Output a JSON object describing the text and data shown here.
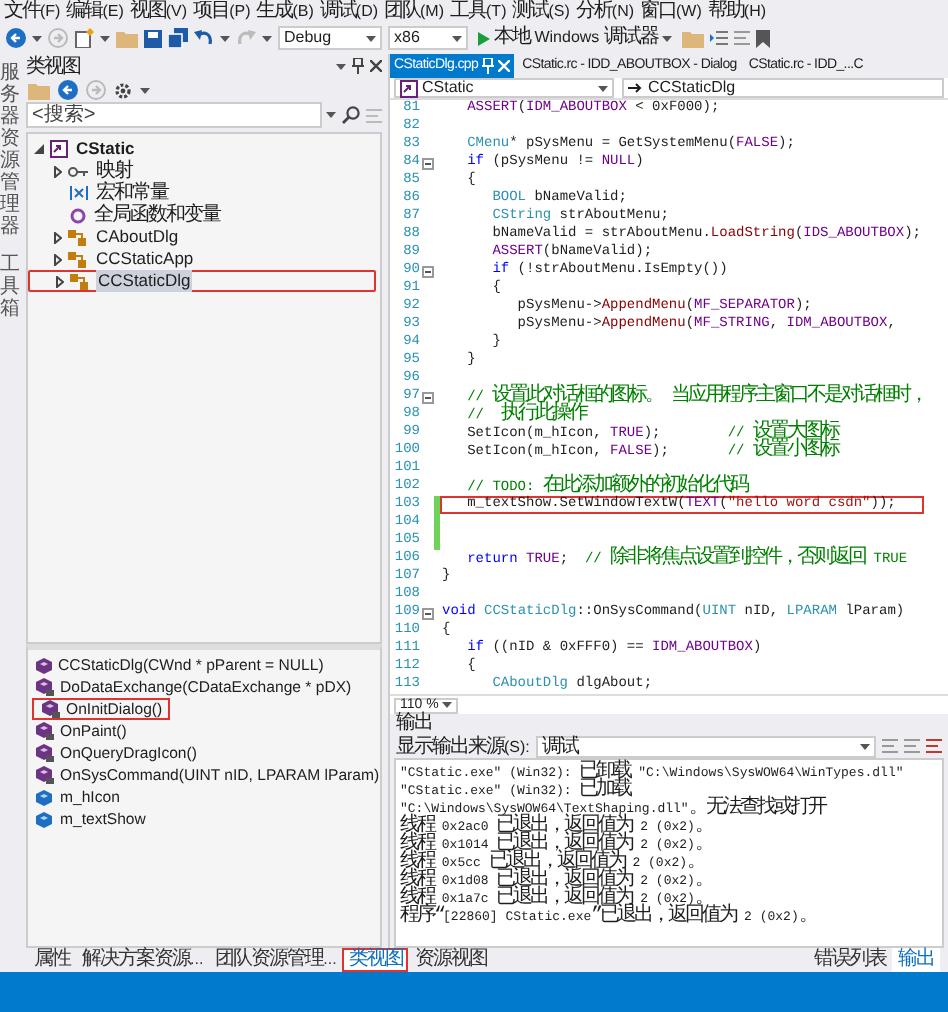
{
  "menu": [
    "文件(F)",
    "编辑(E)",
    "视图(V)",
    "项目(P)",
    "生成(B)",
    "调试(D)",
    "团队(M)",
    "工具(T)",
    "测试(S)",
    "分析(N)",
    "窗口(W)",
    "帮助(H)"
  ],
  "toolbar": {
    "configuration": "Debug",
    "platform": "x86",
    "debugger": "本地 Windows 调试器"
  },
  "side_tabs": [
    "服务器资源管理器",
    "工具箱"
  ],
  "class_view": {
    "title": "类视图",
    "search": {
      "placeholder": "<搜索>"
    },
    "tree": [
      {
        "label": "CStatic",
        "kind": "project",
        "expanded": true,
        "selected": false,
        "annotated": false,
        "children": [
          {
            "label": "映射",
            "kind": "map",
            "expanded": false,
            "selected": false,
            "annotated": false
          },
          {
            "label": "宏和常量",
            "kind": "macro",
            "selected": false,
            "annotated": false
          },
          {
            "label": "全局函数和变量",
            "kind": "global",
            "selected": false,
            "annotated": false
          },
          {
            "label": "CAboutDlg",
            "kind": "class",
            "expanded": false,
            "selected": false,
            "annotated": false
          },
          {
            "label": "CCStaticApp",
            "kind": "class",
            "expanded": false,
            "selected": false,
            "annotated": false
          },
          {
            "label": "CCStaticDlg",
            "kind": "class",
            "expanded": false,
            "selected": true,
            "annotated": true
          }
        ]
      }
    ],
    "members": [
      {
        "label": "CCStaticDlg(CWnd * pParent = NULL)",
        "kind": "method",
        "annotated": false
      },
      {
        "label": "DoDataExchange(CDataExchange * pDX)",
        "kind": "protected-method",
        "annotated": false
      },
      {
        "label": "OnInitDialog()",
        "kind": "protected-method",
        "annotated": true
      },
      {
        "label": "OnPaint()",
        "kind": "protected-method",
        "annotated": false
      },
      {
        "label": "OnQueryDragIcon()",
        "kind": "protected-method",
        "annotated": false
      },
      {
        "label": "OnSysCommand(UINT nID, LPARAM lParam)",
        "kind": "protected-method",
        "annotated": false
      },
      {
        "label": "m_hIcon",
        "kind": "field",
        "annotated": false
      },
      {
        "label": "m_textShow",
        "kind": "field",
        "annotated": false
      }
    ]
  },
  "editor": {
    "tabs": [
      {
        "label": "CStaticDlg.cpp",
        "selected": true
      },
      {
        "label": "CStatic.rc - IDD_ABOUTBOX - Dialog",
        "selected": false
      },
      {
        "label": "CStatic.rc - IDD_...C",
        "selected": false
      }
    ],
    "scope": "CStatic",
    "member": "CCStaticDlg",
    "zoom": "110 %",
    "lines": [
      {
        "number": "81",
        "tokens": [
          {
            "text": "   ASSERT",
            "kind": "macro"
          },
          {
            "text": "(",
            "kind": "plain"
          },
          {
            "text": "IDM_ABOUTBOX",
            "kind": "macro"
          },
          {
            "text": " < 0xF000);",
            "kind": "plain"
          }
        ]
      },
      {
        "number": "82"
      },
      {
        "number": "83",
        "tokens": [
          {
            "text": "   CMenu",
            "kind": "type"
          },
          {
            "text": "* pSysMenu = GetSystemMenu(",
            "kind": "plain"
          },
          {
            "text": "FALSE",
            "kind": "macro"
          },
          {
            "text": ");",
            "kind": "plain"
          }
        ]
      },
      {
        "number": "84",
        "fold": true,
        "tokens": [
          {
            "text": "   if",
            "kind": "keyword"
          },
          {
            "text": " (pSysMenu != ",
            "kind": "plain"
          },
          {
            "text": "NULL",
            "kind": "macro"
          },
          {
            "text": ")",
            "kind": "plain"
          }
        ]
      },
      {
        "number": "85",
        "tokens": [
          {
            "text": "   {",
            "kind": "plain"
          }
        ]
      },
      {
        "number": "86",
        "tokens": [
          {
            "text": "      BOOL",
            "kind": "type"
          },
          {
            "text": " bNameValid;",
            "kind": "plain"
          }
        ]
      },
      {
        "number": "87",
        "tokens": [
          {
            "text": "      CString",
            "kind": "type"
          },
          {
            "text": " strAboutMenu;",
            "kind": "plain"
          }
        ]
      },
      {
        "number": "88",
        "tokens": [
          {
            "text": "      bNameValid = strAboutMenu.",
            "kind": "plain"
          },
          {
            "text": "LoadString",
            "kind": "function"
          },
          {
            "text": "(",
            "kind": "plain"
          },
          {
            "text": "IDS_ABOUTBOX",
            "kind": "macro"
          },
          {
            "text": ");",
            "kind": "plain"
          }
        ]
      },
      {
        "number": "89",
        "tokens": [
          {
            "text": "      ASSERT",
            "kind": "macro"
          },
          {
            "text": "(bNameValid);",
            "kind": "plain"
          }
        ]
      },
      {
        "number": "90",
        "fold": true,
        "tokens": [
          {
            "text": "      if",
            "kind": "keyword"
          },
          {
            "text": " (!strAboutMenu.IsEmpty())",
            "kind": "plain"
          }
        ]
      },
      {
        "number": "91",
        "tokens": [
          {
            "text": "      {",
            "kind": "plain"
          }
        ]
      },
      {
        "number": "92",
        "tokens": [
          {
            "text": "         pSysMenu->",
            "kind": "plain"
          },
          {
            "text": "AppendMenu",
            "kind": "function"
          },
          {
            "text": "(",
            "kind": "plain"
          },
          {
            "text": "MF_SEPARATOR",
            "kind": "macro"
          },
          {
            "text": ");",
            "kind": "plain"
          }
        ]
      },
      {
        "number": "93",
        "tokens": [
          {
            "text": "         pSysMenu->",
            "kind": "plain"
          },
          {
            "text": "AppendMenu",
            "kind": "function"
          },
          {
            "text": "(",
            "kind": "plain"
          },
          {
            "text": "MF_STRING",
            "kind": "macro"
          },
          {
            "text": ", ",
            "kind": "plain"
          },
          {
            "text": "IDM_ABOUTBOX",
            "kind": "macro"
          },
          {
            "text": ",",
            "kind": "plain"
          }
        ]
      },
      {
        "number": "94",
        "tokens": [
          {
            "text": "      }",
            "kind": "plain"
          }
        ]
      },
      {
        "number": "95",
        "tokens": [
          {
            "text": "   }",
            "kind": "plain"
          }
        ]
      },
      {
        "number": "96"
      },
      {
        "number": "97",
        "fold": true,
        "tokens": [
          {
            "text": "   // 设置此对话框的图标。 当应用程序主窗口不是对话框时，",
            "kind": "comment"
          }
        ]
      },
      {
        "number": "98",
        "tokens": [
          {
            "text": "   //  执行此操作",
            "kind": "comment"
          }
        ]
      },
      {
        "number": "99",
        "tokens": [
          {
            "text": "   SetIcon(m_hIcon, ",
            "kind": "plain"
          },
          {
            "text": "TRUE",
            "kind": "macro"
          },
          {
            "text": ");        ",
            "kind": "plain"
          },
          {
            "text": "// 设置大图标",
            "kind": "comment"
          }
        ]
      },
      {
        "number": "100",
        "tokens": [
          {
            "text": "   SetIcon(m_hIcon, ",
            "kind": "plain"
          },
          {
            "text": "FALSE",
            "kind": "macro"
          },
          {
            "text": ");       ",
            "kind": "plain"
          },
          {
            "text": "// 设置小图标",
            "kind": "comment"
          }
        ]
      },
      {
        "number": "101"
      },
      {
        "number": "102",
        "tokens": [
          {
            "text": "   // TODO: 在此添加额外的初始化代码",
            "kind": "comment"
          }
        ]
      },
      {
        "number": "103",
        "changed": true,
        "annotated": true,
        "tokens": [
          {
            "text": "   m_textShow.SetWindowTextW(",
            "kind": "plain"
          },
          {
            "text": "TEXT",
            "kind": "macro"
          },
          {
            "text": "(",
            "kind": "plain"
          },
          {
            "text": "\"hello word csdn\"",
            "kind": "string"
          },
          {
            "text": "));",
            "kind": "plain"
          }
        ]
      },
      {
        "number": "104",
        "changed": true
      },
      {
        "number": "105",
        "changed": true
      },
      {
        "number": "106",
        "tokens": [
          {
            "text": "   return",
            "kind": "keyword"
          },
          {
            "text": " TRUE",
            "kind": "macro"
          },
          {
            "text": ";  ",
            "kind": "plain"
          },
          {
            "text": "// 除非将焦点设置到控件，否则返回 TRUE",
            "kind": "comment"
          }
        ]
      },
      {
        "number": "107",
        "tokens": [
          {
            "text": "}",
            "kind": "plain"
          }
        ]
      },
      {
        "number": "108"
      },
      {
        "number": "109",
        "fold": true,
        "tokens": [
          {
            "text": "void",
            "kind": "keyword"
          },
          {
            "text": " CCStaticDlg",
            "kind": "type"
          },
          {
            "text": "::OnSysCommand(",
            "kind": "plain"
          },
          {
            "text": "UINT",
            "kind": "type"
          },
          {
            "text": " nID, ",
            "kind": "plain"
          },
          {
            "text": "LPARAM",
            "kind": "type"
          },
          {
            "text": " lParam)",
            "kind": "plain"
          }
        ]
      },
      {
        "number": "110",
        "tokens": [
          {
            "text": "{",
            "kind": "plain"
          }
        ]
      },
      {
        "number": "111",
        "tokens": [
          {
            "text": "   if",
            "kind": "keyword"
          },
          {
            "text": " ((nID & 0xFFF0) == ",
            "kind": "plain"
          },
          {
            "text": "IDM_ABOUTBOX",
            "kind": "macro"
          },
          {
            "text": ")",
            "kind": "plain"
          }
        ]
      },
      {
        "number": "112",
        "tokens": [
          {
            "text": "   {",
            "kind": "plain"
          }
        ]
      },
      {
        "number": "113",
        "tokens": [
          {
            "text": "      CAboutDlg",
            "kind": "type"
          },
          {
            "text": " dlgAbout;",
            "kind": "plain"
          }
        ]
      }
    ]
  },
  "output": {
    "title": "输出",
    "source_label": "显示输出来源(S):",
    "source": "调试",
    "lines": [
      "\"CStatic.exe\" (Win32): 已卸载 \"C:\\Windows\\SysWOW64\\WinTypes.dll\"",
      "\"CStatic.exe\" (Win32): 已加载 \"C:\\Windows\\SysWOW64\\TextShaping.dll\"。无法查找或打开",
      "线程 0x2ac0 已退出，返回值为 2 (0x2)。",
      "线程 0x1014 已退出，返回值为 2 (0x2)。",
      "线程 0x5cc 已退出，返回值为 2 (0x2)。",
      "线程 0x1d08 已退出，返回值为 2 (0x2)。",
      "线程 0x1a7c 已退出，返回值为 2 (0x2)。",
      "程序“[22860] CStatic.exe”已退出，返回值为 2 (0x2)。"
    ]
  },
  "bottom_tabs_left": [
    {
      "label": "属性",
      "selected": false,
      "annotated": false
    },
    {
      "label": "解决方案资源...",
      "selected": false,
      "annotated": false
    },
    {
      "label": "团队资源管理...",
      "selected": false,
      "annotated": false
    },
    {
      "label": "类视图",
      "selected": true,
      "annotated": true
    },
    {
      "label": "资源视图",
      "selected": false,
      "annotated": false
    }
  ],
  "bottom_tabs_right": [
    {
      "label": "错误列表",
      "selected": false
    },
    {
      "label": "输出",
      "selected": true
    }
  ]
}
